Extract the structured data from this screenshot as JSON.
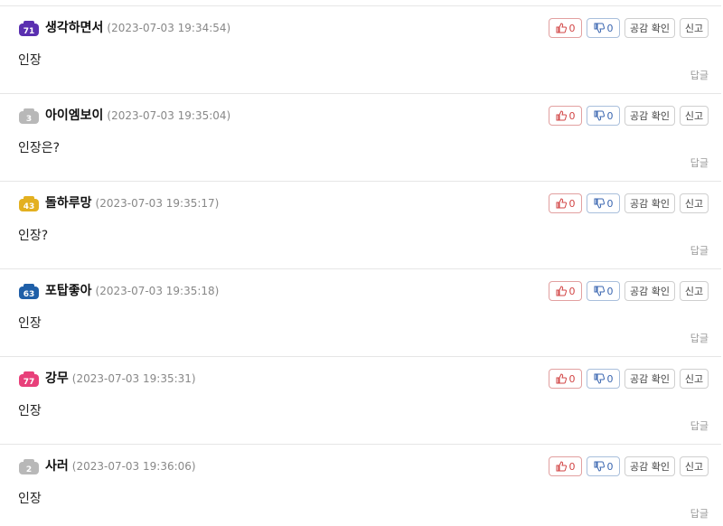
{
  "comments": [
    {
      "nick": "생각하면서",
      "date": "(2023-07-03 19:34:54)",
      "text": "인장",
      "level": "71",
      "badge_color": "#5a2fb0",
      "likes": "0",
      "dislikes": "0"
    },
    {
      "nick": "아이엠보이",
      "date": "(2023-07-03 19:35:04)",
      "text": "인장은?",
      "level": "3",
      "badge_color": "#b8b8b8",
      "likes": "0",
      "dislikes": "0"
    },
    {
      "nick": "돌하루망",
      "date": "(2023-07-03 19:35:17)",
      "text": "인장?",
      "level": "43",
      "badge_color": "#e3b020",
      "likes": "0",
      "dislikes": "0"
    },
    {
      "nick": "포탑좋아",
      "date": "(2023-07-03 19:35:18)",
      "text": "인장",
      "level": "63",
      "badge_color": "#1f5fa8",
      "likes": "0",
      "dislikes": "0"
    },
    {
      "nick": "강무",
      "date": "(2023-07-03 19:35:31)",
      "text": "인장",
      "level": "77",
      "badge_color": "#e8407a",
      "likes": "0",
      "dislikes": "0"
    },
    {
      "nick": "사러",
      "date": "(2023-07-03 19:36:06)",
      "text": "인장",
      "level": "2",
      "badge_color": "#b8b8b8",
      "likes": "0",
      "dislikes": "0"
    }
  ],
  "labels": {
    "empathy": "공감 확인",
    "report": "신고",
    "reply": "답글"
  }
}
